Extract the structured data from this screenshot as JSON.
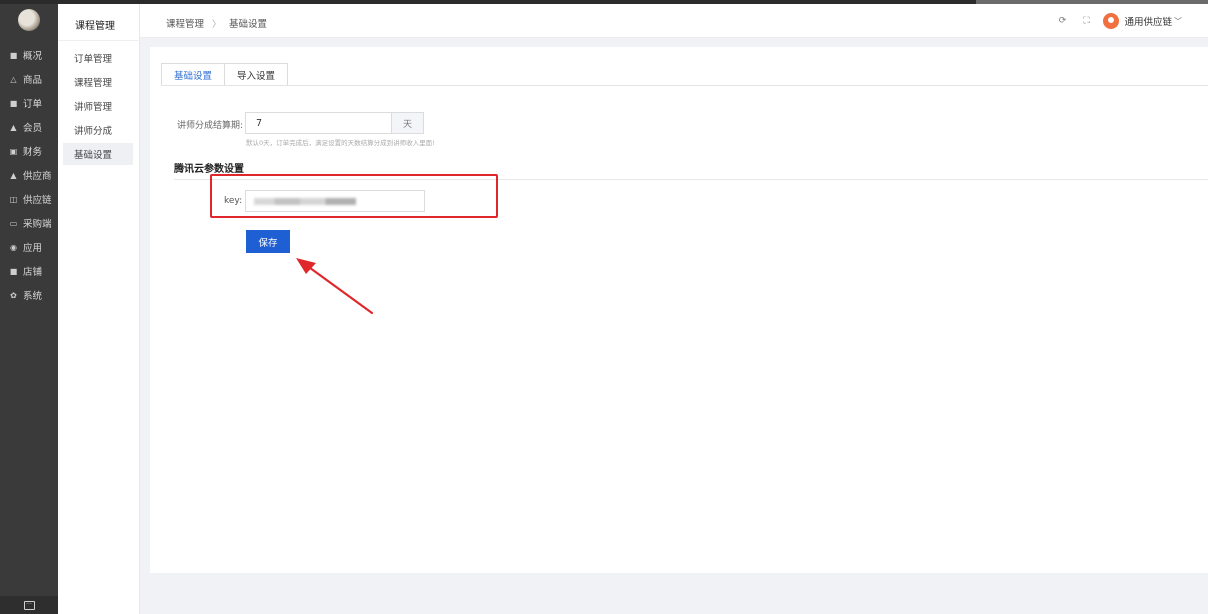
{
  "nav": {
    "items": [
      {
        "icon": "square-icon",
        "glyph": "■",
        "label": "概况"
      },
      {
        "icon": "bag-icon",
        "glyph": "△",
        "label": "商品"
      },
      {
        "icon": "order-icon",
        "glyph": "■",
        "label": "订单"
      },
      {
        "icon": "user-icon",
        "glyph": "▲",
        "label": "会员"
      },
      {
        "icon": "finance-icon",
        "glyph": "▣",
        "label": "财务"
      },
      {
        "icon": "supplier-icon",
        "glyph": "▲",
        "label": "供应商"
      },
      {
        "icon": "chain-icon",
        "glyph": "◫",
        "label": "供应链"
      },
      {
        "icon": "monitor-icon",
        "glyph": "▭",
        "label": "采购端"
      },
      {
        "icon": "app-icon",
        "glyph": "◉",
        "label": "应用"
      },
      {
        "icon": "shop-icon",
        "glyph": "■",
        "label": "店铺"
      },
      {
        "icon": "gear-icon",
        "glyph": "✿",
        "label": "系统"
      }
    ],
    "bottom_icon": "chat-icon"
  },
  "subnav": {
    "title": "课程管理",
    "items": [
      {
        "label": "订单管理",
        "active": false
      },
      {
        "label": "课程管理",
        "active": false
      },
      {
        "label": "讲师管理",
        "active": false
      },
      {
        "label": "讲师分成",
        "active": false
      },
      {
        "label": "基础设置",
        "active": true
      }
    ]
  },
  "header": {
    "breadcrumb": [
      "课程管理",
      "基础设置"
    ],
    "breadcrumb_sep": "〉",
    "user_name": "通用供应链"
  },
  "tabs": [
    {
      "label": "基础设置",
      "active": true
    },
    {
      "label": "导入设置",
      "active": false
    }
  ],
  "form": {
    "settle_label": "讲师分成结算期:",
    "settle_value": "7",
    "settle_unit": "天",
    "settle_hint": "默认0天，订单完成后，满足设置的天数结算分成到讲师收入里面!",
    "section_title": "腾讯云参数设置",
    "key_label": "key:",
    "save_label": "保存"
  },
  "colors": {
    "primary": "#1f5fd4",
    "highlight_box": "#e0282c",
    "nav_bg": "#3a3a3a",
    "tab_active": "#2f6fd6"
  }
}
